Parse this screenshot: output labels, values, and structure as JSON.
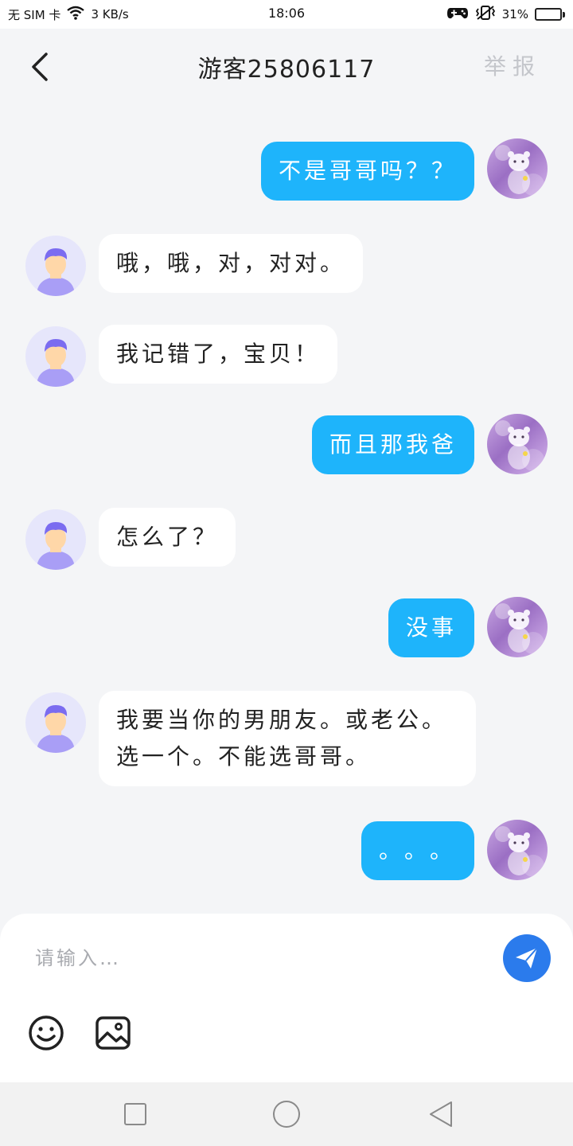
{
  "status_bar": {
    "carrier": "无 SIM 卡",
    "network_speed": "3 KB/s",
    "time": "18:06",
    "battery_percent": "31%",
    "battery_level": 0.31,
    "icons": [
      "wifi-icon",
      "gamepad-icon",
      "vibrate-icon",
      "battery-icon"
    ]
  },
  "header": {
    "title": "游客25806117",
    "report_label": "举报"
  },
  "messages": [
    {
      "direction": "out",
      "text": "不是哥哥吗？？"
    },
    {
      "direction": "in",
      "text": "哦，哦，对，对对。"
    },
    {
      "direction": "in",
      "text": "我记错了，宝贝！"
    },
    {
      "direction": "out",
      "text": "而且那我爸"
    },
    {
      "direction": "in",
      "text": "怎么了？"
    },
    {
      "direction": "out",
      "text": "没事"
    },
    {
      "direction": "in",
      "text": "我要当你的男朋友。或老公。选一个。不能选哥哥。"
    },
    {
      "direction": "out",
      "text": "。。。"
    }
  ],
  "composer": {
    "placeholder": "请输入…",
    "value": ""
  },
  "colors": {
    "outgoing_bubble": "#1eb4fb",
    "incoming_bubble": "#ffffff",
    "send_button": "#2b7bec",
    "guest_avatar_bg": "#e6e6fb",
    "guest_avatar_hair": "#7b6cf0"
  },
  "nav": {
    "icons": [
      "recent-apps-icon",
      "home-icon",
      "back-triangle-icon"
    ]
  }
}
